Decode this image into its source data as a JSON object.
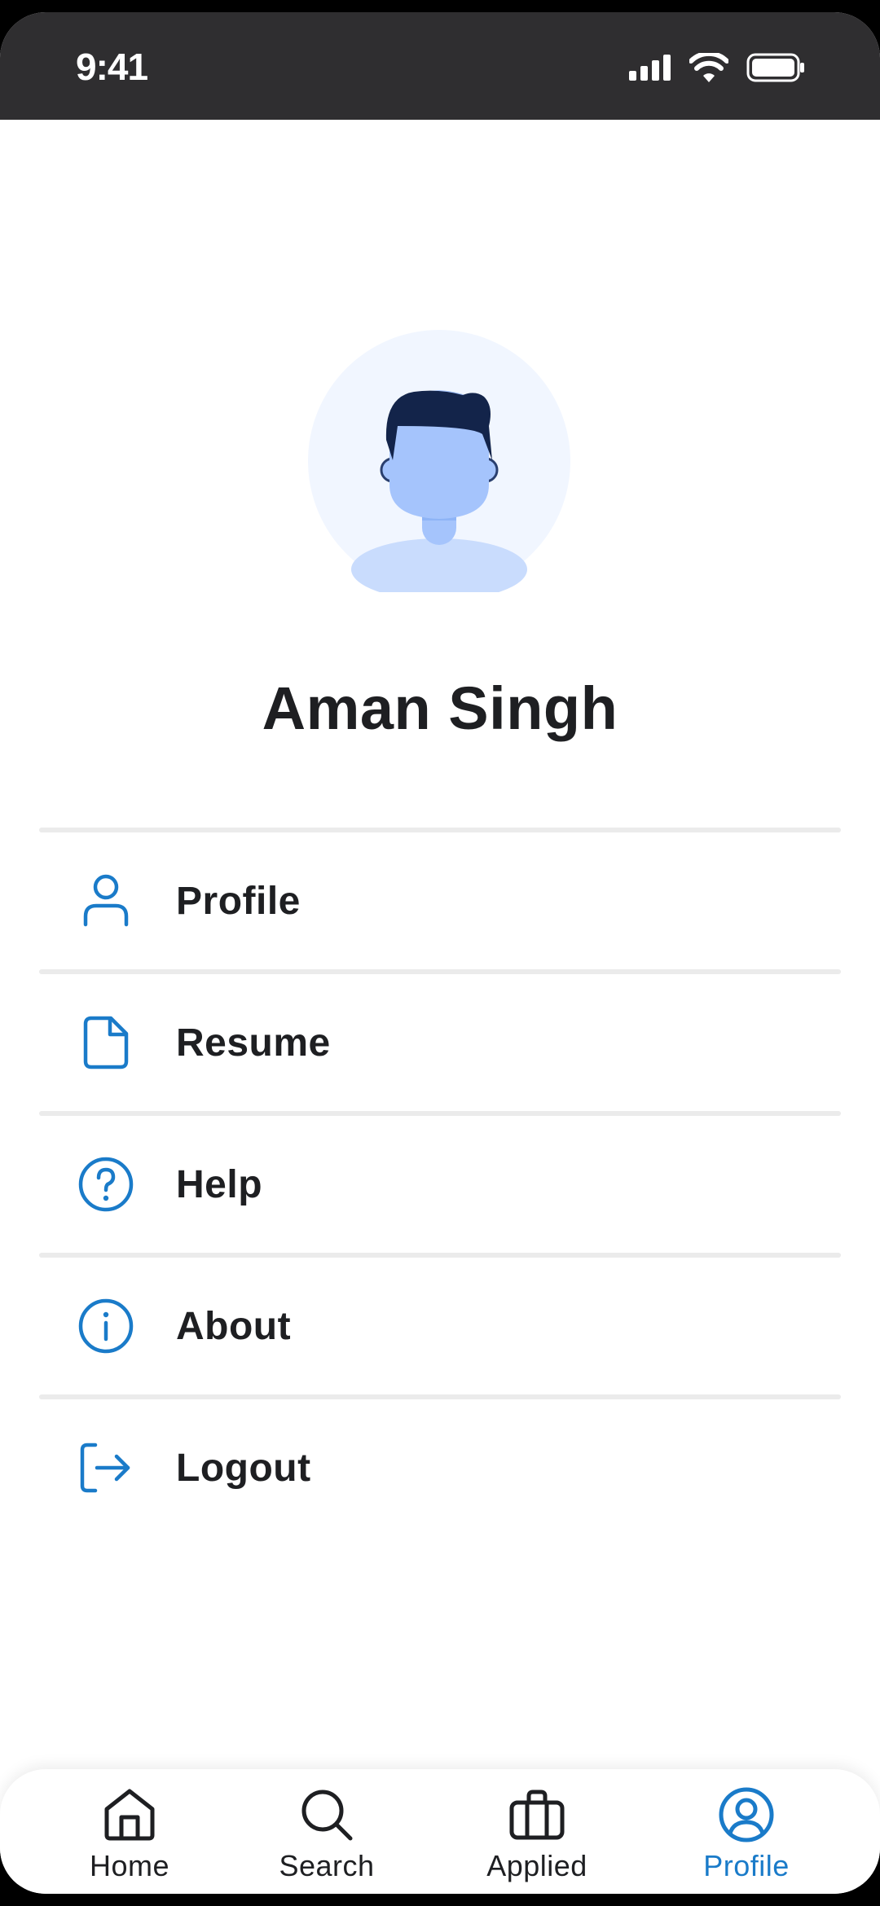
{
  "status_bar": {
    "time": "9:41",
    "icons": [
      "cellular-signal-icon",
      "wifi-icon",
      "battery-icon"
    ]
  },
  "profile": {
    "name": "Aman Singh",
    "avatar_icon": "person-avatar-illustration"
  },
  "menu": {
    "items": [
      {
        "label": "Profile",
        "icon": "user-icon"
      },
      {
        "label": "Resume",
        "icon": "document-icon"
      },
      {
        "label": "Help",
        "icon": "help-circle-icon"
      },
      {
        "label": "About",
        "icon": "info-circle-icon"
      },
      {
        "label": "Logout",
        "icon": "logout-icon"
      }
    ]
  },
  "bottom_nav": {
    "items": [
      {
        "label": "Home",
        "icon": "home-icon"
      },
      {
        "label": "Search",
        "icon": "search-icon"
      },
      {
        "label": "Applied",
        "icon": "briefcase-icon"
      },
      {
        "label": "Profile",
        "icon": "user-circle-icon"
      }
    ],
    "active": "Profile"
  },
  "colors": {
    "accent": "#1a7bc9",
    "text": "#1e1f22",
    "status_bar_bg": "#2f2e30",
    "divider": "#ebebeb",
    "avatar_bg": "#f1f6ff",
    "avatar_skin": "#a5c4fc",
    "avatar_hair": "#13244a"
  }
}
